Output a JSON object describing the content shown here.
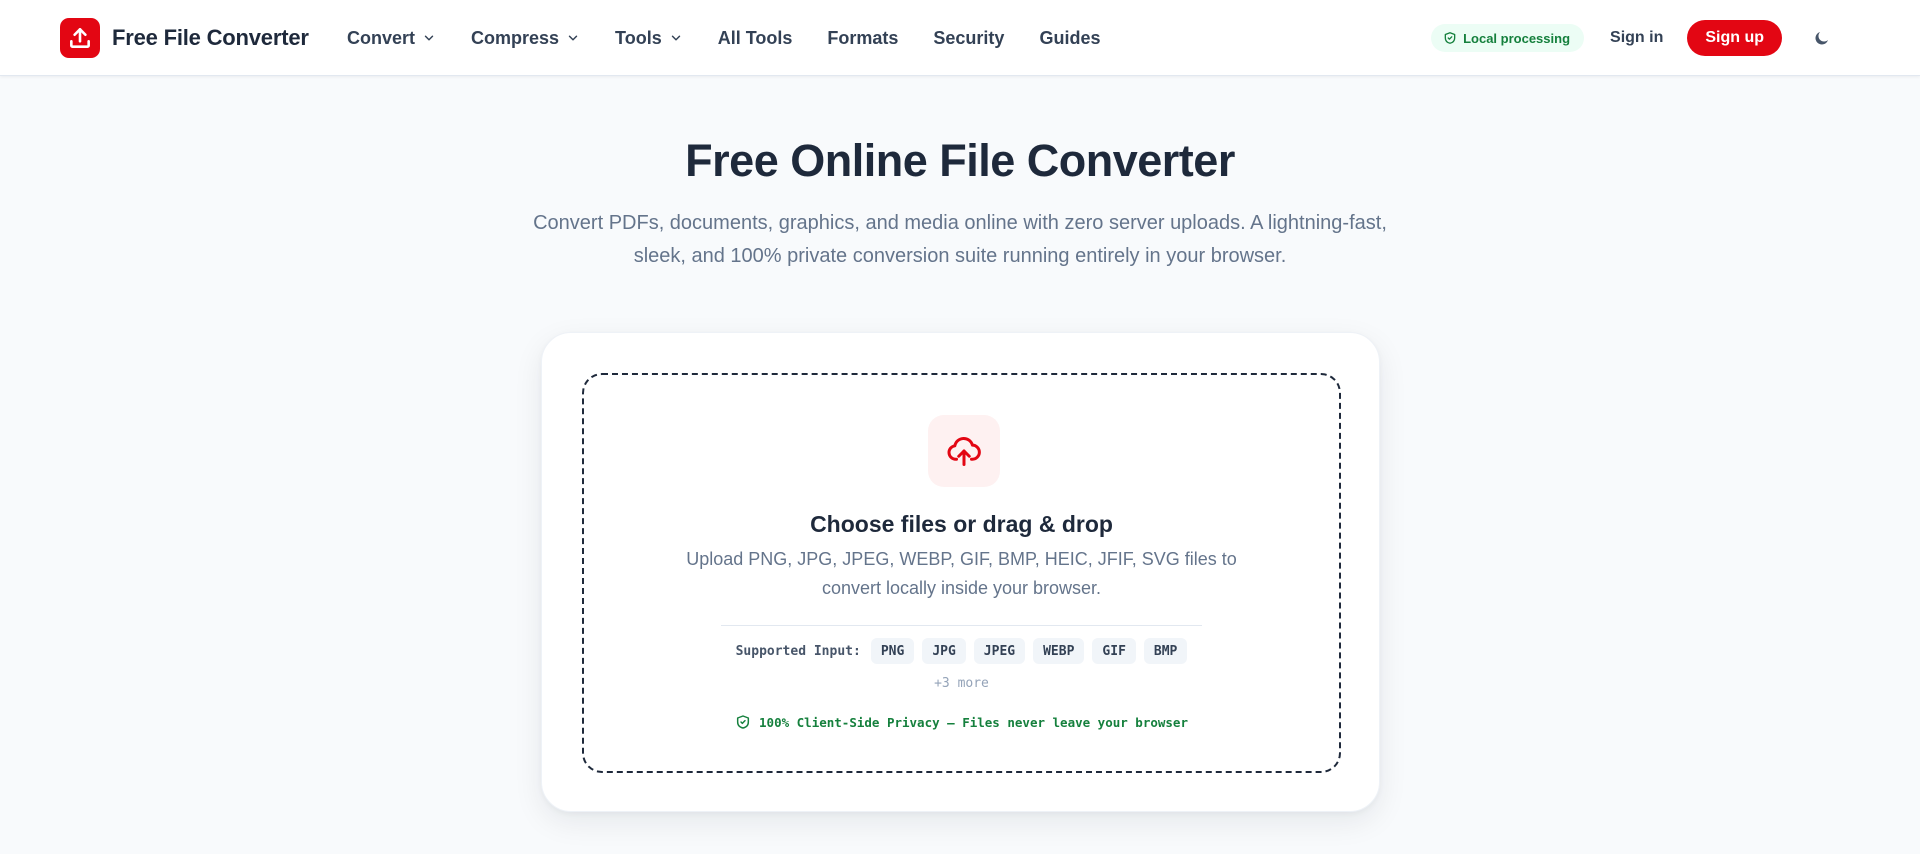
{
  "header": {
    "brand": "Free File Converter",
    "nav": [
      {
        "label": "Convert",
        "dropdown": true
      },
      {
        "label": "Compress",
        "dropdown": true
      },
      {
        "label": "Tools",
        "dropdown": true
      },
      {
        "label": "All Tools",
        "dropdown": false
      },
      {
        "label": "Formats",
        "dropdown": false
      },
      {
        "label": "Security",
        "dropdown": false
      },
      {
        "label": "Guides",
        "dropdown": false
      }
    ],
    "local_badge": "Local processing",
    "signin": "Sign in",
    "signup": "Sign up",
    "theme_icon": "moon-icon"
  },
  "hero": {
    "title": "Free Online File Converter",
    "subtitle": "Convert PDFs, documents, graphics, and media online with zero server uploads. A lightning-fast, sleek, and 100% private conversion suite running entirely in your browser."
  },
  "dropzone": {
    "icon": "cloud-upload-icon",
    "title": "Choose files or drag & drop",
    "description": "Upload PNG, JPG, JPEG, WEBP, GIF, BMP, HEIC, JFIF, SVG files to convert locally inside your browser.",
    "supported_label": "Supported Input:",
    "formats": [
      "PNG",
      "JPG",
      "JPEG",
      "WEBP",
      "GIF",
      "BMP"
    ],
    "more": "+3 more",
    "privacy": "100% Client-Side Privacy — Files never leave your browser"
  },
  "colors": {
    "accent": "#e30613",
    "success": "#15803d",
    "text": "#1e293b",
    "muted": "#64748b",
    "background": "#f8fafc"
  }
}
